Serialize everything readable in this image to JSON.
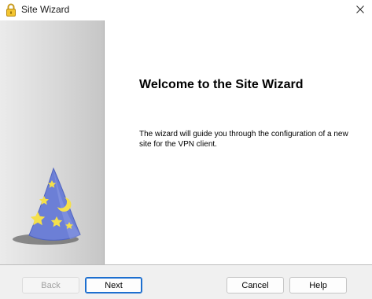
{
  "window": {
    "title": "Site Wizard",
    "title_icon": "padlock-icon",
    "close_icon": "close-icon"
  },
  "side_panel": {
    "illustration": "wizard-hat-icon"
  },
  "content": {
    "heading": "Welcome to the Site Wizard",
    "description": "The wizard will guide you through the configuration of a new site for the VPN client."
  },
  "buttons": {
    "back": "Back",
    "next": "Next",
    "cancel": "Cancel",
    "help": "Help"
  },
  "colors": {
    "accent": "#1d6fcf",
    "hat": "#6c7fd6",
    "stars": "#f5e04a"
  }
}
